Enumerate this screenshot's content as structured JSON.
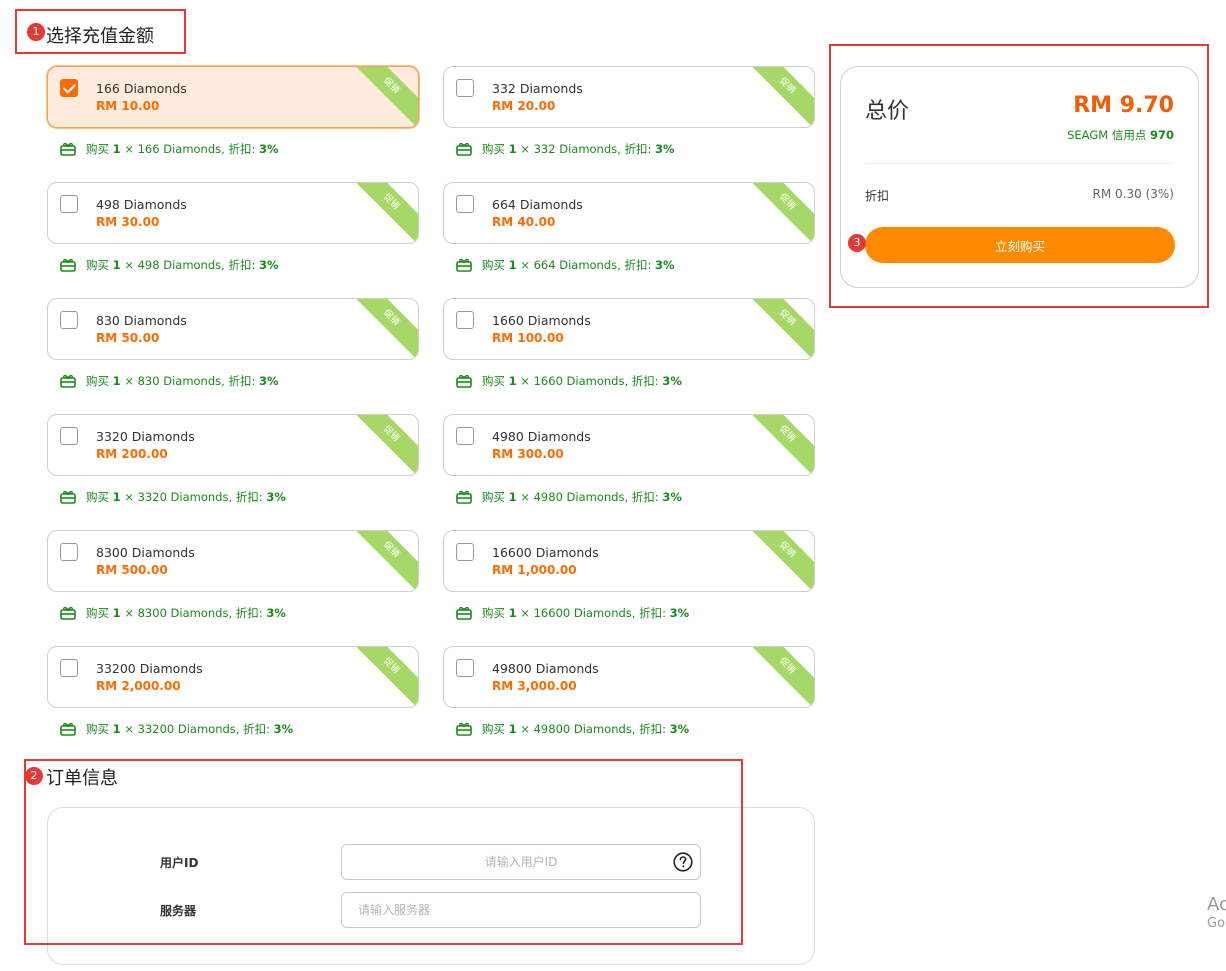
{
  "sections": {
    "select_amount": {
      "number": "1",
      "title": "选择充值金额"
    },
    "order_info": {
      "number": "2",
      "title": "订单信息"
    },
    "summary_number": "3"
  },
  "colors": {
    "accent": "#ff6b00",
    "buy_button": "#ff8a00",
    "promo_green": "#1b8a1b",
    "ribbon": "#a7d867",
    "annotation_red": "#e53935"
  },
  "ribbon_label": "促销",
  "products": [
    {
      "name": "166 Diamonds",
      "price": "RM 10.00",
      "selected": true,
      "promo": {
        "prefix": "购买",
        "qty": "1",
        "desc": " × 166 Diamonds, 折扣: ",
        "discount": "3%"
      }
    },
    {
      "name": "332 Diamonds",
      "price": "RM 20.00",
      "selected": false,
      "promo": {
        "prefix": "购买",
        "qty": "1",
        "desc": " × 332 Diamonds, 折扣: ",
        "discount": "3%"
      }
    },
    {
      "name": "498 Diamonds",
      "price": "RM 30.00",
      "selected": false,
      "promo": {
        "prefix": "购买",
        "qty": "1",
        "desc": " × 498 Diamonds, 折扣: ",
        "discount": "3%"
      }
    },
    {
      "name": "664 Diamonds",
      "price": "RM 40.00",
      "selected": false,
      "promo": {
        "prefix": "购买",
        "qty": "1",
        "desc": " × 664 Diamonds, 折扣: ",
        "discount": "3%"
      }
    },
    {
      "name": "830 Diamonds",
      "price": "RM 50.00",
      "selected": false,
      "promo": {
        "prefix": "购买",
        "qty": "1",
        "desc": " × 830 Diamonds, 折扣: ",
        "discount": "3%"
      }
    },
    {
      "name": "1660 Diamonds",
      "price": "RM 100.00",
      "selected": false,
      "promo": {
        "prefix": "购买",
        "qty": "1",
        "desc": " × 1660 Diamonds, 折扣: ",
        "discount": "3%"
      }
    },
    {
      "name": "3320 Diamonds",
      "price": "RM 200.00",
      "selected": false,
      "promo": {
        "prefix": "购买",
        "qty": "1",
        "desc": " × 3320 Diamonds, 折扣: ",
        "discount": "3%"
      }
    },
    {
      "name": "4980 Diamonds",
      "price": "RM 300.00",
      "selected": false,
      "promo": {
        "prefix": "购买",
        "qty": "1",
        "desc": " × 4980 Diamonds, 折扣: ",
        "discount": "3%"
      }
    },
    {
      "name": "8300 Diamonds",
      "price": "RM 500.00",
      "selected": false,
      "promo": {
        "prefix": "购买",
        "qty": "1",
        "desc": " × 8300 Diamonds, 折扣: ",
        "discount": "3%"
      }
    },
    {
      "name": "16600 Diamonds",
      "price": "RM 1,000.00",
      "selected": false,
      "promo": {
        "prefix": "购买",
        "qty": "1",
        "desc": " × 16600 Diamonds, 折扣: ",
        "discount": "3%"
      }
    },
    {
      "name": "33200 Diamonds",
      "price": "RM 2,000.00",
      "selected": false,
      "promo": {
        "prefix": "购买",
        "qty": "1",
        "desc": " × 33200 Diamonds, 折扣: ",
        "discount": "3%"
      }
    },
    {
      "name": "49800 Diamonds",
      "price": "RM 3,000.00",
      "selected": false,
      "promo": {
        "prefix": "购买",
        "qty": "1",
        "desc": " × 49800 Diamonds, 折扣: ",
        "discount": "3%"
      }
    }
  ],
  "summary": {
    "total_label": "总价",
    "total_price": "RM 9.70",
    "credits_label": "SEAGM 信用点 ",
    "credits_value": "970",
    "discount_label": "折扣",
    "discount_value": "RM 0.30 (3%)",
    "buy_label": "立刻购买"
  },
  "order": {
    "user_id_label": "用户ID",
    "user_id_placeholder": "请输入用户ID",
    "server_label": "服务器",
    "server_placeholder": "请输入服务器"
  },
  "watermark": {
    "line1": "Ac",
    "line2": "Go"
  }
}
